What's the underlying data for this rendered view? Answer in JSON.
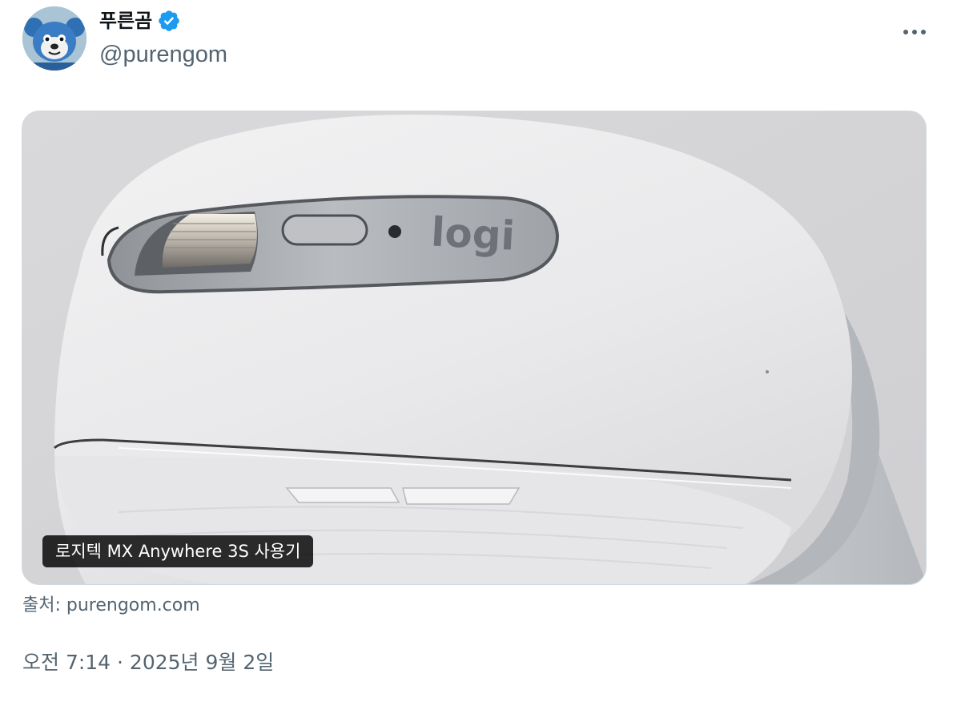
{
  "author": {
    "display_name": "푸른곰",
    "handle": "@purengom",
    "verified": true,
    "avatar_icon": "blue-bear-avatar-icon",
    "verified_icon": "verified-badge-icon",
    "verified_color": "#1d9bf0"
  },
  "menu": {
    "more_icon": "more-horizontal-icon"
  },
  "media": {
    "caption": "로지텍 MX Anywhere 3S 사용기",
    "logo_text": "logi"
  },
  "source": {
    "text": "출처: purengom.com"
  },
  "timestamp": {
    "text": "오전 7:14 · 2025년 9월 2일"
  },
  "colors": {
    "text_primary": "#0f1419",
    "text_secondary": "#536471",
    "border": "#cfd9de"
  }
}
